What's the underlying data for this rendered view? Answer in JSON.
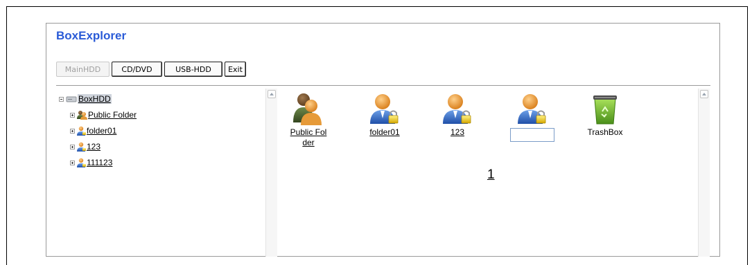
{
  "app": {
    "title": "BoxExplorer"
  },
  "toolbar": {
    "buttons": [
      {
        "label": "MainHDD",
        "disabled": true
      },
      {
        "label": "CD/DVD",
        "disabled": false
      },
      {
        "label": "USB-HDD",
        "disabled": false
      },
      {
        "label": "Exit",
        "disabled": false
      }
    ]
  },
  "tree": {
    "root": "BoxHDD",
    "items": [
      {
        "label": "Public Folder",
        "icon": "shared-users-icon"
      },
      {
        "label": "folder01",
        "icon": "locked-user-icon"
      },
      {
        "label": "123",
        "icon": "locked-user-icon"
      },
      {
        "label": "111123",
        "icon": "locked-user-icon"
      }
    ]
  },
  "content": {
    "items": [
      {
        "label": "Public Fol\nder",
        "label_line1": "Public Fol",
        "label_line2": "der",
        "icon": "shared-users-icon"
      },
      {
        "label": "folder01",
        "icon": "locked-user-icon"
      },
      {
        "label": "123",
        "icon": "locked-user-icon"
      },
      {
        "label": "",
        "icon": "locked-user-icon",
        "editing": true
      },
      {
        "label": "TrashBox",
        "icon": "trash-icon"
      }
    ],
    "rename_value": ""
  },
  "pagination": {
    "current": "1"
  },
  "colors": {
    "title": "#2a5bd7",
    "user_orange": "#e8902a",
    "user_blue": "#3a6fc8",
    "lock_gold": "#e6c200",
    "trash_green": "#6bb42a"
  }
}
